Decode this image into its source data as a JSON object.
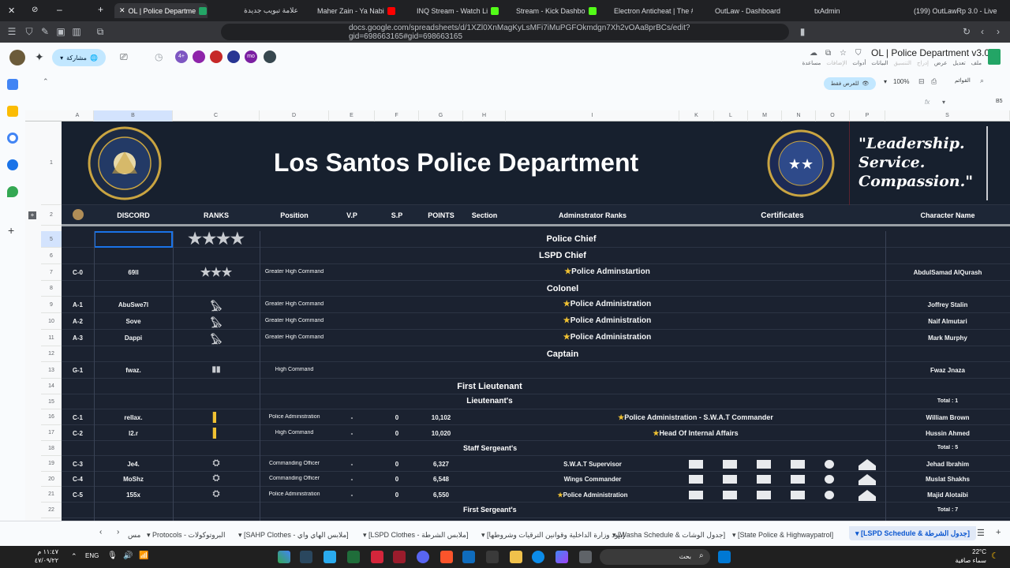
{
  "browser": {
    "tabs": [
      {
        "label": "OL | Police Departme",
        "active": true
      },
      {
        "label": "علامة تبويب جديدة"
      },
      {
        "label": "Maher Zain - Ya Nabi"
      },
      {
        "label": "INQ Stream - Watch Li"
      },
      {
        "label": "Stream - Kick Dashbo"
      },
      {
        "label": "Electron Anticheat | The #"
      },
      {
        "label": "OutLaw - Dashboard"
      },
      {
        "label": "txAdmin"
      },
      {
        "label": "(199) OutLawRp 3.0 - Live"
      }
    ],
    "url": "docs.google.com/spreadsheets/d/1XZl0XnMagKyLsMFi7iMuPGFOkmdgn7Xh2vOAa8prBCs/edit?gid=698663165#gid=698663165"
  },
  "sheets": {
    "doc_title": "OL | Police Department v3.0",
    "menu": [
      "ملف",
      "تعديل",
      "عرض",
      "إدراج",
      "التنسيق",
      "البيانات",
      "أدوات",
      "الإضافات",
      "مساعدة"
    ],
    "share_label": "مشاركة",
    "view_only_label": "للعرض فقط",
    "zoom": "100%",
    "menus_label": "القوائم",
    "name_box": "B5",
    "collab_count": "4+",
    "collab_initials": "mo"
  },
  "columns": [
    "A",
    "B",
    "C",
    "D",
    "E",
    "F",
    "G",
    "H",
    "I",
    "K",
    "L",
    "M",
    "N",
    "O",
    "P",
    "S"
  ],
  "rows": [
    "1",
    "2",
    "5",
    "6",
    "7",
    "8",
    "9",
    "10",
    "11",
    "12",
    "13",
    "14",
    "15",
    "16",
    "17",
    "18",
    "19",
    "20",
    "21",
    "22"
  ],
  "banner": {
    "title": "Los Santos Police Department",
    "quote_line1": "\"Leadership.",
    "quote_line2": "Service.",
    "quote_line3": "Compassion.\"",
    "badge_text_top": "LOS SANTOS POLICE DEPARTMENT",
    "badge_text_bottom": "TO PROTECT AND TO SERVE",
    "seal_text": "CITY OF LOS SANTOS"
  },
  "headers": {
    "discord": "DISCORD",
    "ranks": "RANKS",
    "position": "Position",
    "vp": "V.P",
    "sp": "S.P",
    "points": "POINTS",
    "section": "Section",
    "admin_ranks": "Adminstrator Ranks",
    "certificates": "Certificates",
    "character_name": "Character Name"
  },
  "sections": {
    "police_chief": "Police Chief",
    "lspd_chief": "LSPD Chief",
    "colonel": "Colonel",
    "captain": "Captain",
    "first_lieutenant": "First Lieutenant",
    "lieutenants": "Lieutenant's",
    "staff_sergeants": "Staff Sergeant's",
    "first_sergeants": "First Sergeant's",
    "total_1": "Total : 1",
    "total_5": "Total : 5",
    "total_7": "Total : 7"
  },
  "members": [
    {
      "id": "C-0",
      "discord": "69ll",
      "position": "Greater High Command",
      "admin": "Police Adminstartion",
      "name": "AbdulSamad AlQurash"
    },
    {
      "id": "A-1",
      "discord": "AbuSwe7l",
      "position": "Greater High Command",
      "admin": "Police Administration",
      "name": "Joffrey Stalin"
    },
    {
      "id": "A-2",
      "discord": "Sove",
      "position": "Greater High Command",
      "admin": "Police Administration",
      "name": "Naif Almutari"
    },
    {
      "id": "A-3",
      "discord": "Dappi",
      "position": "Greater High Command",
      "admin": "Police Administration",
      "name": "Mark Murphy"
    },
    {
      "id": "G-1",
      "discord": "fwaz.",
      "position": "High Command",
      "admin": "",
      "name": "Fwaz Jnaza"
    },
    {
      "id": "C-1",
      "discord": "rellax.",
      "position": "Police Administration",
      "vp": "-",
      "sp": "0",
      "points": "10,102",
      "admin": "Police Administration - S.W.A.T Commander",
      "name": "William Brown"
    },
    {
      "id": "C-2",
      "discord": "l2.r",
      "position": "High Command",
      "vp": "-",
      "sp": "0",
      "points": "10,020",
      "admin": "Head Of Internal Affairs",
      "name": "Hussin Ahmed"
    },
    {
      "id": "C-3",
      "discord": "Je4.",
      "position": "Commanding Officer",
      "vp": "-",
      "sp": "0",
      "points": "6,327",
      "admin": "S.W.A.T Supervisor",
      "name": "Jehad Ibrahim"
    },
    {
      "id": "C-4",
      "discord": "MoShz",
      "position": "Commanding Officer",
      "vp": "-",
      "sp": "0",
      "points": "6,548",
      "admin": "Wings Commander",
      "name": "Muslat Shakhs"
    },
    {
      "id": "C-5",
      "discord": "155x",
      "position": "Police Administration",
      "vp": "-",
      "sp": "0",
      "points": "6,550",
      "admin": "Police Administration",
      "name": "Majid Alotaibi"
    }
  ],
  "sheet_tabs": [
    "مس",
    "Protocols - البروتوكولات",
    "[SAHP Clothes - ملابس الهاي واي]",
    "[LSPD Clothes - ملابس الشرطة]",
    "[بنود وزارة الداخلية وقوانين الترقيات وشروطها]",
    "[Washa Schedule & جدول الوشات]",
    "[State Police & Highwaypatrol]",
    "[LSPD Schedule & جدول الشرطة]"
  ],
  "taskbar": {
    "time": "١١:٤٧ م",
    "date": "٤٧/٠٩/٢٢",
    "lang": "ENG",
    "temp": "22°C",
    "weather": "سماء صافية",
    "search": "بحث"
  },
  "colors": {
    "sheet_bg": "#1b2230",
    "gold": "#f1c232",
    "accent": "#0b57d0"
  }
}
